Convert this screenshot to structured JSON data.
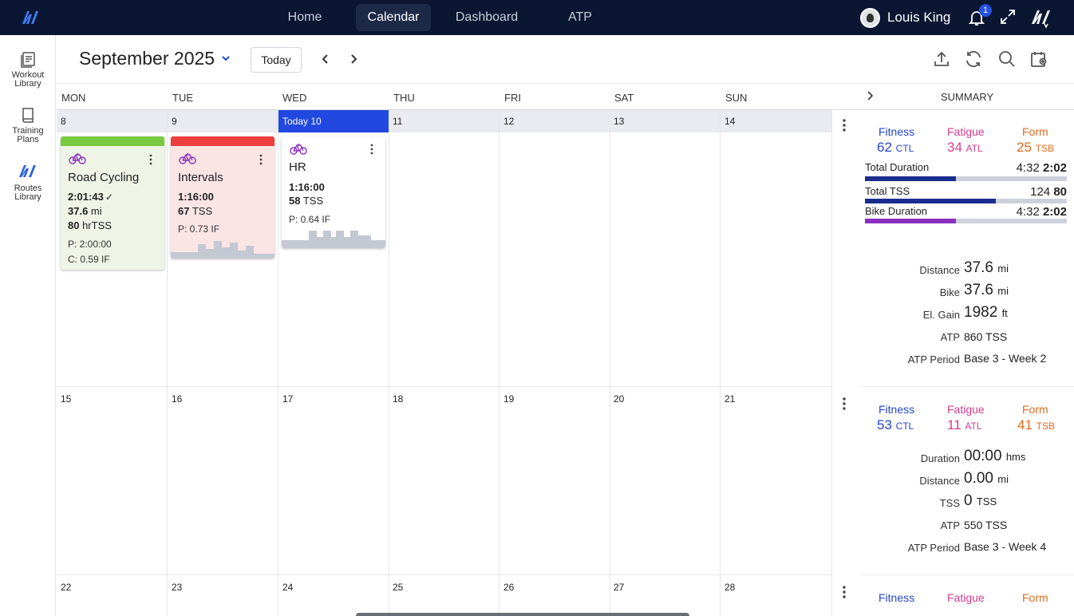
{
  "nav": {
    "tabs": [
      {
        "label": "Home"
      },
      {
        "label": "Calendar"
      },
      {
        "label": "Dashboard"
      },
      {
        "label": "ATP"
      }
    ],
    "user_name": "Louis King",
    "notification_count": "1"
  },
  "sidebar": {
    "items": [
      {
        "label_1": "Workout",
        "label_2": "Library",
        "icon": "workout-library-icon"
      },
      {
        "label_1": "Training",
        "label_2": "Plans",
        "icon": "book-icon"
      },
      {
        "label_1": "Routes",
        "label_2": "Library",
        "icon": "routes-icon"
      }
    ]
  },
  "header": {
    "month": "September 2025",
    "today_label": "Today"
  },
  "days": [
    "MON",
    "TUE",
    "WED",
    "THU",
    "FRI",
    "SAT",
    "SUN"
  ],
  "summary_title": "SUMMARY",
  "weeks": [
    {
      "dates": [
        "8",
        "9",
        "Today 10",
        "11",
        "12",
        "13",
        "14"
      ]
    },
    {
      "dates": [
        "15",
        "16",
        "17",
        "18",
        "19",
        "20",
        "21"
      ]
    },
    {
      "dates": [
        "22",
        "23",
        "24",
        "25",
        "26",
        "27",
        "28"
      ]
    }
  ],
  "workouts": [
    {
      "title": "Road Cycling",
      "color": "#7ac943",
      "duration": "2:01:43",
      "check": "✓",
      "distance_val": "37.6",
      "distance_unit": " mi",
      "load_val": "80",
      "load_unit": " hrTSS",
      "planned": "P: 2:00:00",
      "compliance": "C: 0.59 IF"
    },
    {
      "title": "Intervals",
      "color": "#ef3e3e",
      "duration": "1:16:00",
      "load_val": "67",
      "load_unit": " TSS",
      "planned": "P: 0.73 IF"
    },
    {
      "title": "HR",
      "duration": "1:16:00",
      "load_val": "58",
      "load_unit": " TSS",
      "planned": "P: 0.64 IF"
    }
  ],
  "summary": {
    "labels": {
      "fitness": "Fitness",
      "fatigue": "Fatigue",
      "form": "Form"
    },
    "week1": {
      "fitness": "62",
      "fitness_unit": "CTL",
      "fatigue": "34",
      "fatigue_unit": "ATL",
      "form": "25",
      "form_unit": "TSB",
      "bars": [
        {
          "label": "Total Duration",
          "actual": "4:32",
          "planned": "2:02",
          "fill": 0.45,
          "color": "#1a2d8f"
        },
        {
          "label": "Total TSS",
          "actual": "124",
          "planned": "80",
          "fill": 0.65,
          "color": "#1a2d8f"
        },
        {
          "label": "Bike Duration",
          "actual": "4:32",
          "planned": "2:02",
          "fill": 0.45,
          "color": "#8a2fc0"
        }
      ],
      "stats": [
        {
          "label": "Distance",
          "value": "37.6",
          "unit": "mi"
        },
        {
          "label": "Bike",
          "value": "37.6",
          "unit": "mi"
        },
        {
          "label": "El. Gain",
          "value": "1982",
          "unit": "ft"
        },
        {
          "label": "ATP",
          "value": "860",
          "unit": "TSS"
        },
        {
          "label": "ATP Period",
          "value": "Base 3 - Week 2",
          "unit": ""
        }
      ]
    },
    "week2": {
      "fitness": "53",
      "fitness_unit": "CTL",
      "fatigue": "11",
      "fatigue_unit": "ATL",
      "form": "41",
      "form_unit": "TSB",
      "stats": [
        {
          "label": "Duration",
          "value": "00:00",
          "unit": "hms"
        },
        {
          "label": "Distance",
          "value": "0.00",
          "unit": "mi"
        },
        {
          "label": "TSS",
          "value": "0",
          "unit": "TSS"
        },
        {
          "label": "ATP",
          "value": "550",
          "unit": "TSS"
        },
        {
          "label": "ATP Period",
          "value": "Base 3 - Week 4",
          "unit": ""
        }
      ]
    }
  }
}
